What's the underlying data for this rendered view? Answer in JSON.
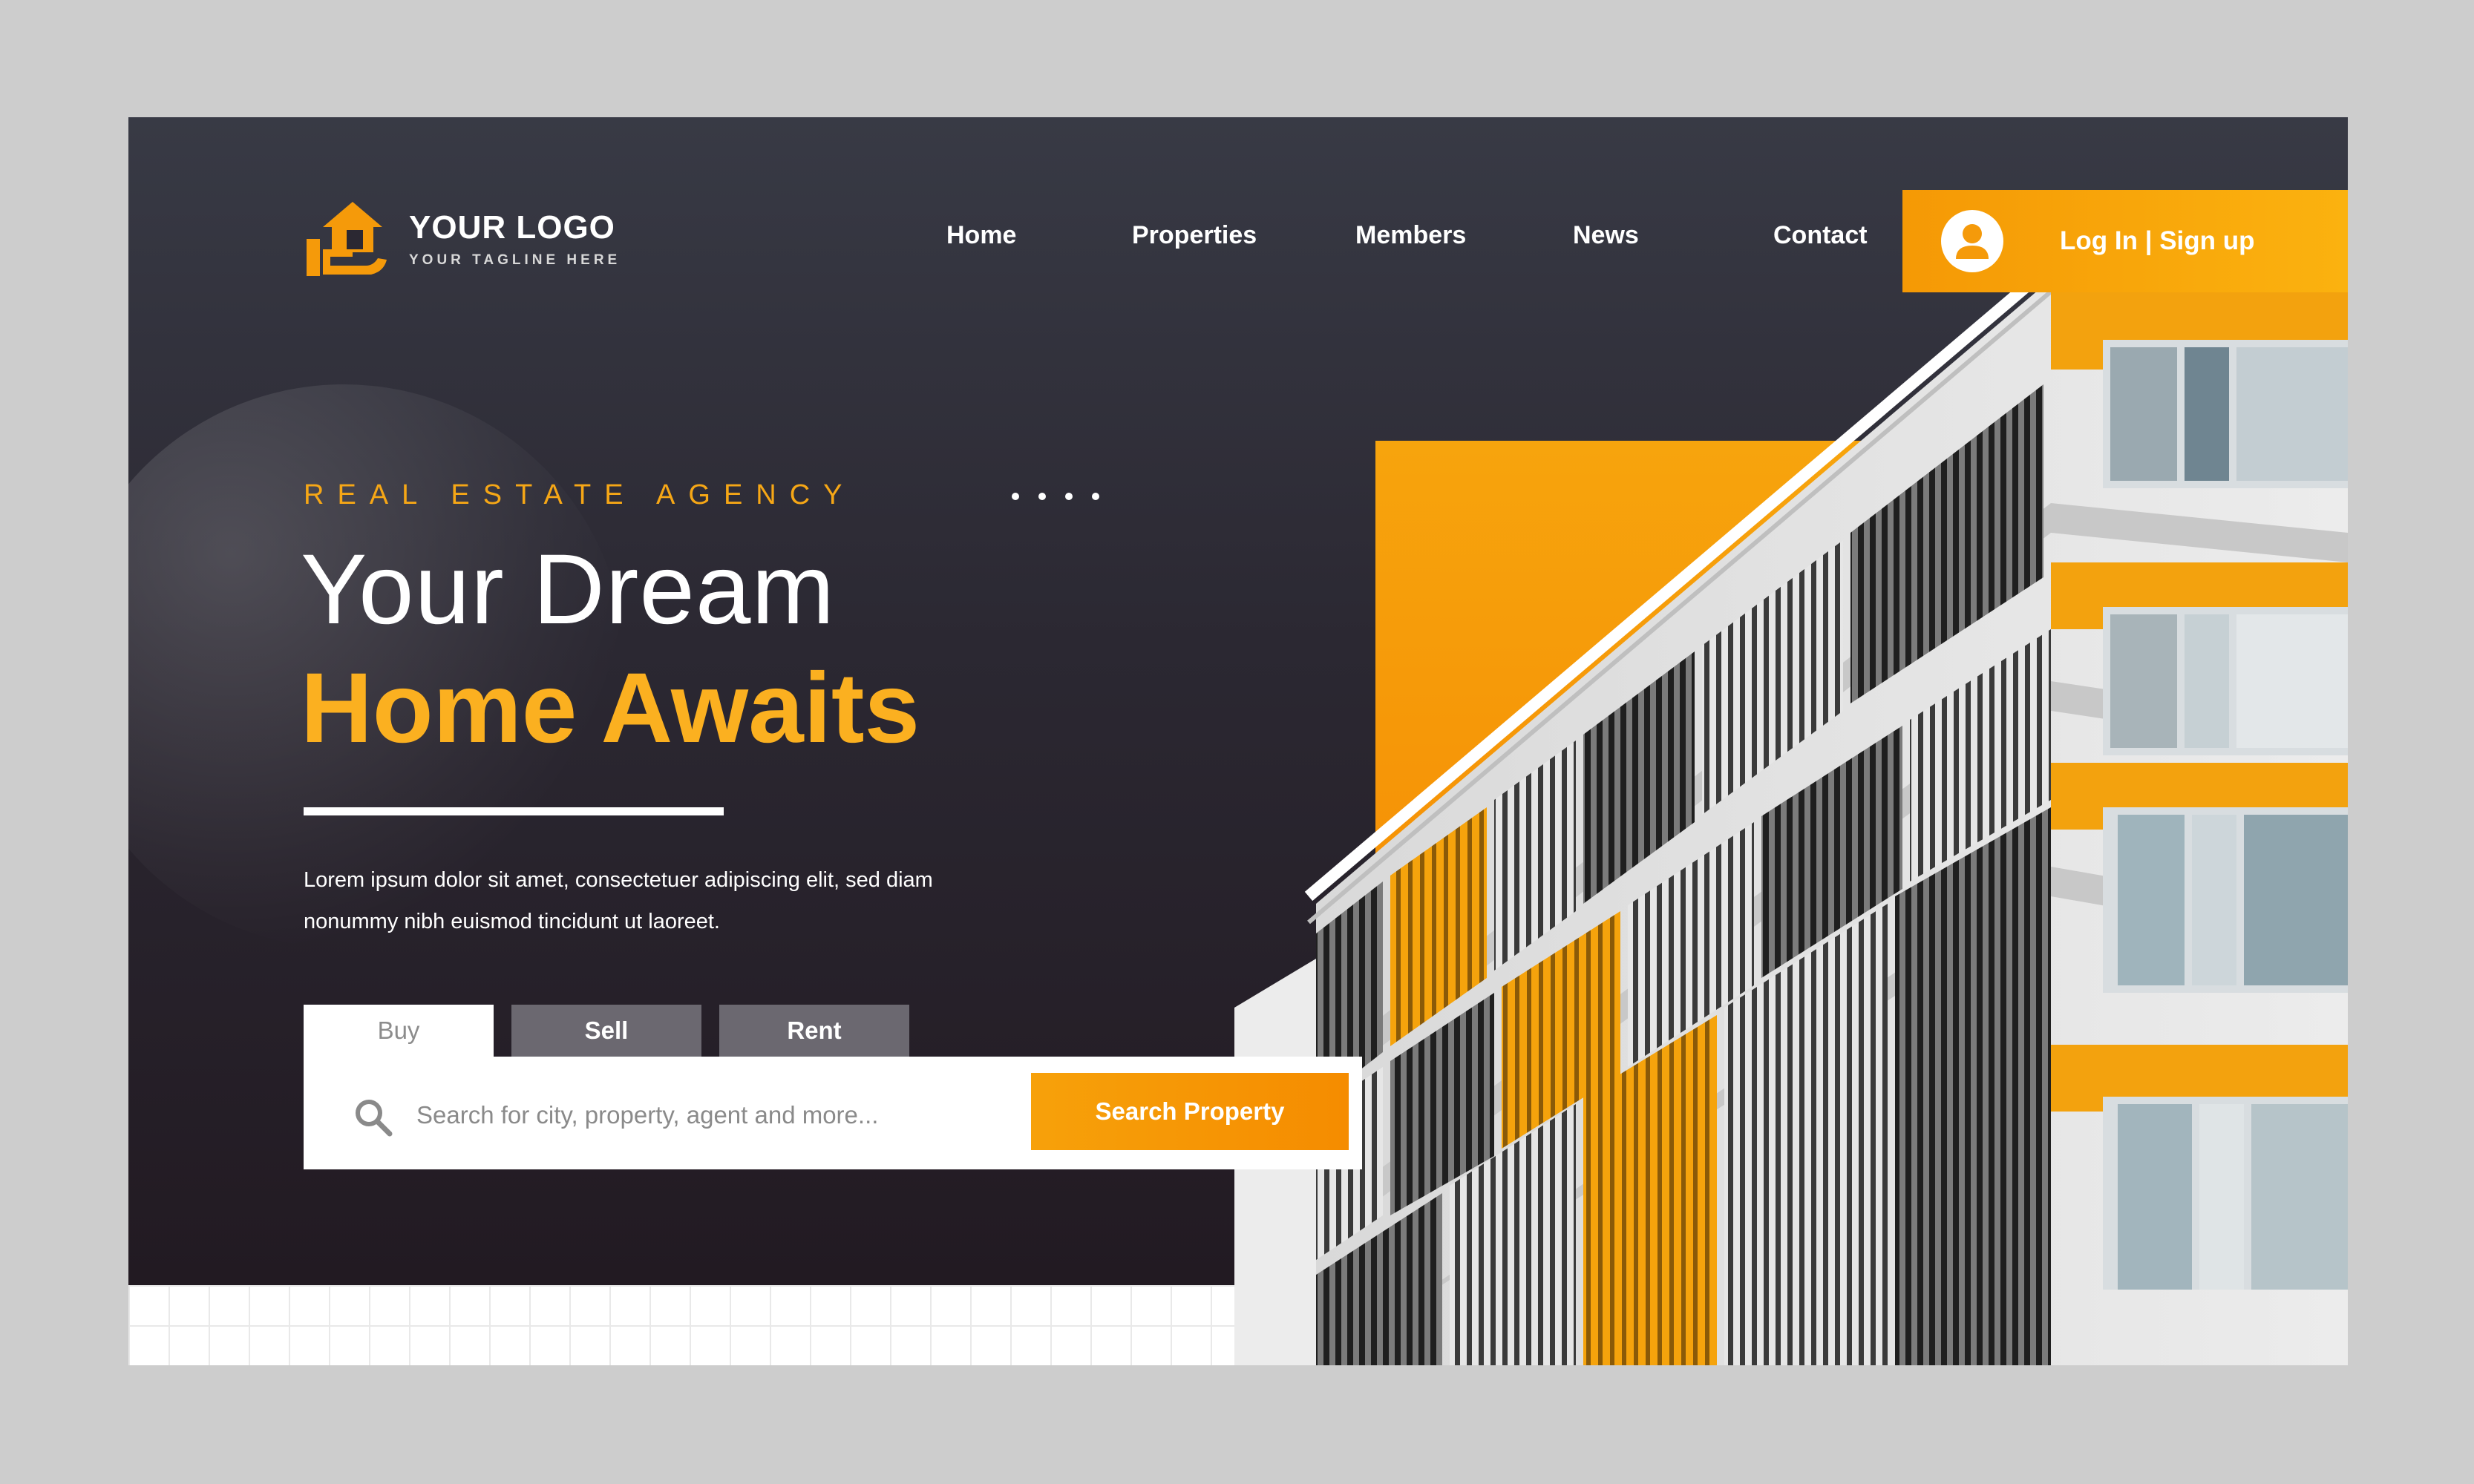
{
  "brand": {
    "name": "YOUR LOGO",
    "tagline": "YOUR TAGLINE HERE",
    "accent": "#f7a10a",
    "dark": "#2b2832"
  },
  "nav": {
    "items": [
      "Home",
      "Properties",
      "Members",
      "News",
      "Contact"
    ]
  },
  "auth": {
    "label": "Log In | Sign up",
    "icon": "user-avatar-icon"
  },
  "hero": {
    "eyebrow": "REAL ESTATE AGENCY",
    "headline_line1": "Your Dream",
    "headline_line2": "Home Awaits",
    "description": "Lorem ipsum dolor sit amet, consectetuer adipiscing elit, sed diam nonummy nibh euismod tincidunt ut laoreet."
  },
  "search": {
    "tabs": [
      "Buy",
      "Sell",
      "Rent"
    ],
    "active_tab": "Buy",
    "placeholder": "Search for city, property, agent and more...",
    "value": "",
    "button_label": "Search Property",
    "icon": "search-icon"
  }
}
